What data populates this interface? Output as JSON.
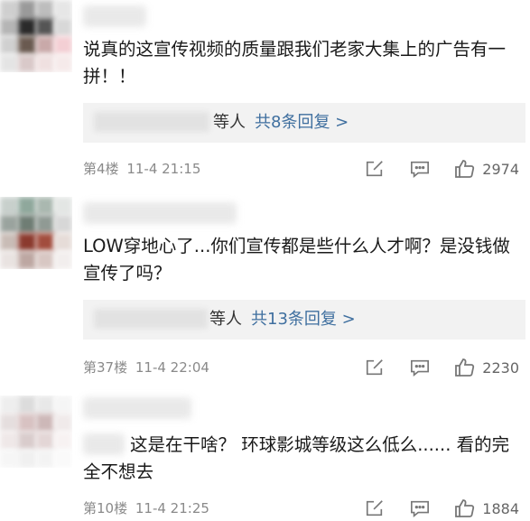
{
  "comments": [
    {
      "content": "说真的这宣传视频的质量跟我们老家大集上的广告有一拼！！",
      "reply_suffix": "等人",
      "reply_link": "共8条回复 >",
      "floor": "第4楼",
      "time": "11-4 21:15",
      "likes": "2974"
    },
    {
      "content": "LOW穿地心了...你们宣传都是些什么人才啊？是没钱做宣传了吗？",
      "reply_suffix": "等人",
      "reply_link": "共13条回复 >",
      "floor": "第37楼",
      "time": "11-4 22:04",
      "likes": "2230"
    },
    {
      "content": "这是在干啥？ 环球影城等级这么低么...... 看的完全不想去",
      "floor": "第10楼",
      "time": "11-4 21:25",
      "likes": "1884"
    }
  ],
  "icons": {
    "edit": "edit-icon",
    "comment": "comment-icon",
    "like": "thumbs-up-icon"
  },
  "colors": {
    "link": "#3f6f9f",
    "meta": "#8a8a8a",
    "reply_bg": "#f2f2f2"
  }
}
